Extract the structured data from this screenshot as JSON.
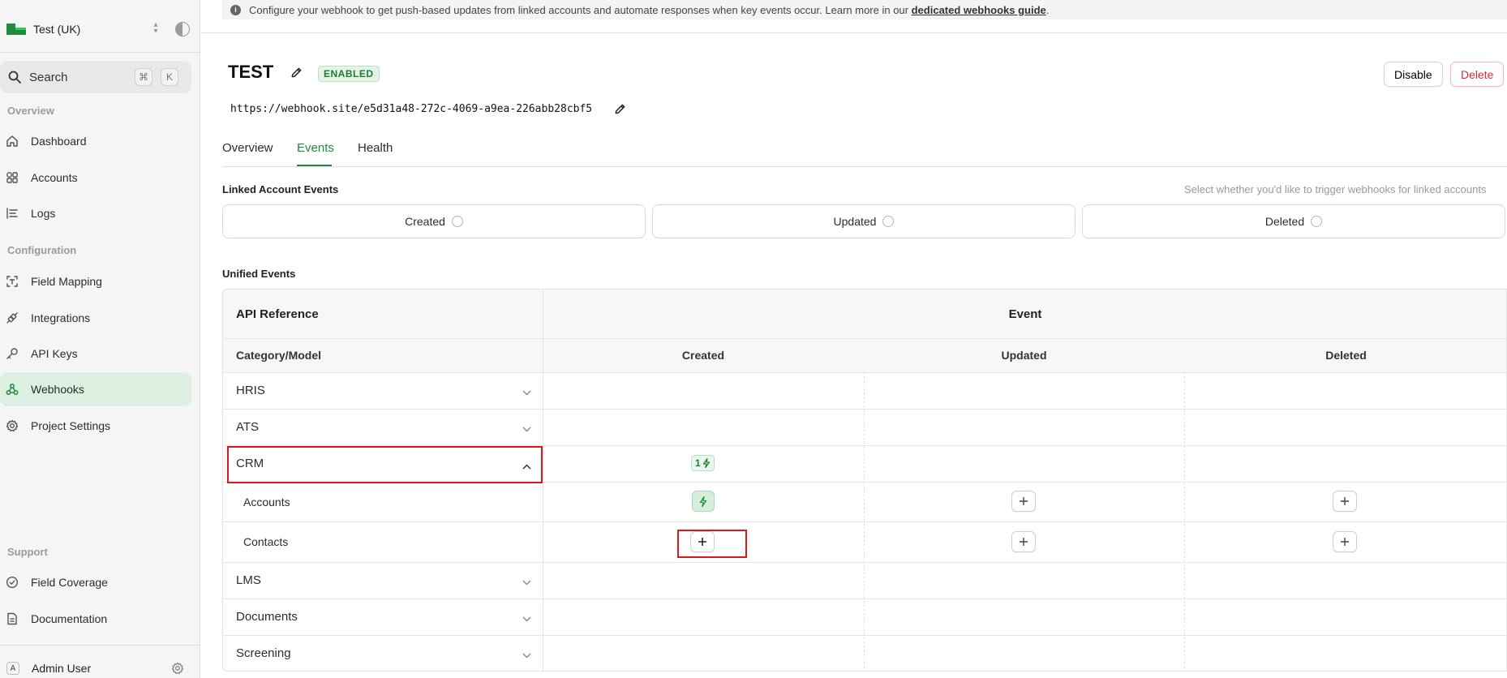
{
  "sidebar": {
    "workspace_name": "Test (UK)",
    "search": {
      "label": "Search",
      "shortcut_mod": "⌘",
      "shortcut_key": "K"
    },
    "sections": {
      "overview": "Overview",
      "configuration": "Configuration",
      "support": "Support"
    },
    "items": [
      {
        "label": "Dashboard",
        "icon": "home-icon"
      },
      {
        "label": "Accounts",
        "icon": "accounts-icon"
      },
      {
        "label": "Logs",
        "icon": "logs-icon"
      },
      {
        "label": "Field Mapping",
        "icon": "field-mapping-icon"
      },
      {
        "label": "Integrations",
        "icon": "integrations-icon"
      },
      {
        "label": "API Keys",
        "icon": "key-icon"
      },
      {
        "label": "Webhooks",
        "icon": "webhooks-icon",
        "active": true
      },
      {
        "label": "Project Settings",
        "icon": "gear-icon"
      },
      {
        "label": "Field Coverage",
        "icon": "check-circle-icon"
      },
      {
        "label": "Documentation",
        "icon": "document-icon"
      }
    ],
    "user": {
      "initial": "A",
      "name": "Admin User"
    }
  },
  "banner": {
    "text": "Configure your webhook to get push-based updates from linked accounts and automate responses when key events occur. Learn more in our ",
    "link": "dedicated webhooks guide",
    "suffix": "."
  },
  "webhook": {
    "name": "TEST",
    "status": "ENABLED",
    "url": "https://webhook.site/e5d31a48-272c-4069-a9ea-226abb28cbf5",
    "disable_label": "Disable",
    "delete_label": "Delete"
  },
  "tabs": [
    "Overview",
    "Events",
    "Health"
  ],
  "active_tab": "Events",
  "linked_account_events": {
    "title": "Linked Account Events",
    "hint": "Select whether you'd like to trigger webhooks for linked accounts",
    "options": [
      {
        "label": "Created",
        "checked": false
      },
      {
        "label": "Updated",
        "checked": false
      },
      {
        "label": "Deleted",
        "checked": false
      }
    ]
  },
  "unified_events": {
    "title": "Unified Events",
    "api_reference": "API Reference",
    "event_header": "Event",
    "category_header": "Category/Model",
    "columns": [
      "Created",
      "Updated",
      "Deleted"
    ],
    "rows": [
      {
        "label": "HRIS",
        "expanded": false
      },
      {
        "label": "ATS",
        "expanded": false
      },
      {
        "label": "CRM",
        "expanded": true,
        "created_count": "1"
      },
      {
        "label": "Accounts",
        "child": true,
        "created": "enabled",
        "updated": "add",
        "deleted": "add"
      },
      {
        "label": "Contacts",
        "child": true,
        "created": "add",
        "updated": "add",
        "deleted": "add"
      },
      {
        "label": "LMS",
        "expanded": false
      },
      {
        "label": "Documents",
        "expanded": false
      },
      {
        "label": "Screening",
        "expanded": false
      }
    ]
  },
  "colors": {
    "accent_green": "#1e8c3a",
    "danger_red": "#d32f2f",
    "highlight_red": "#e0161b"
  }
}
